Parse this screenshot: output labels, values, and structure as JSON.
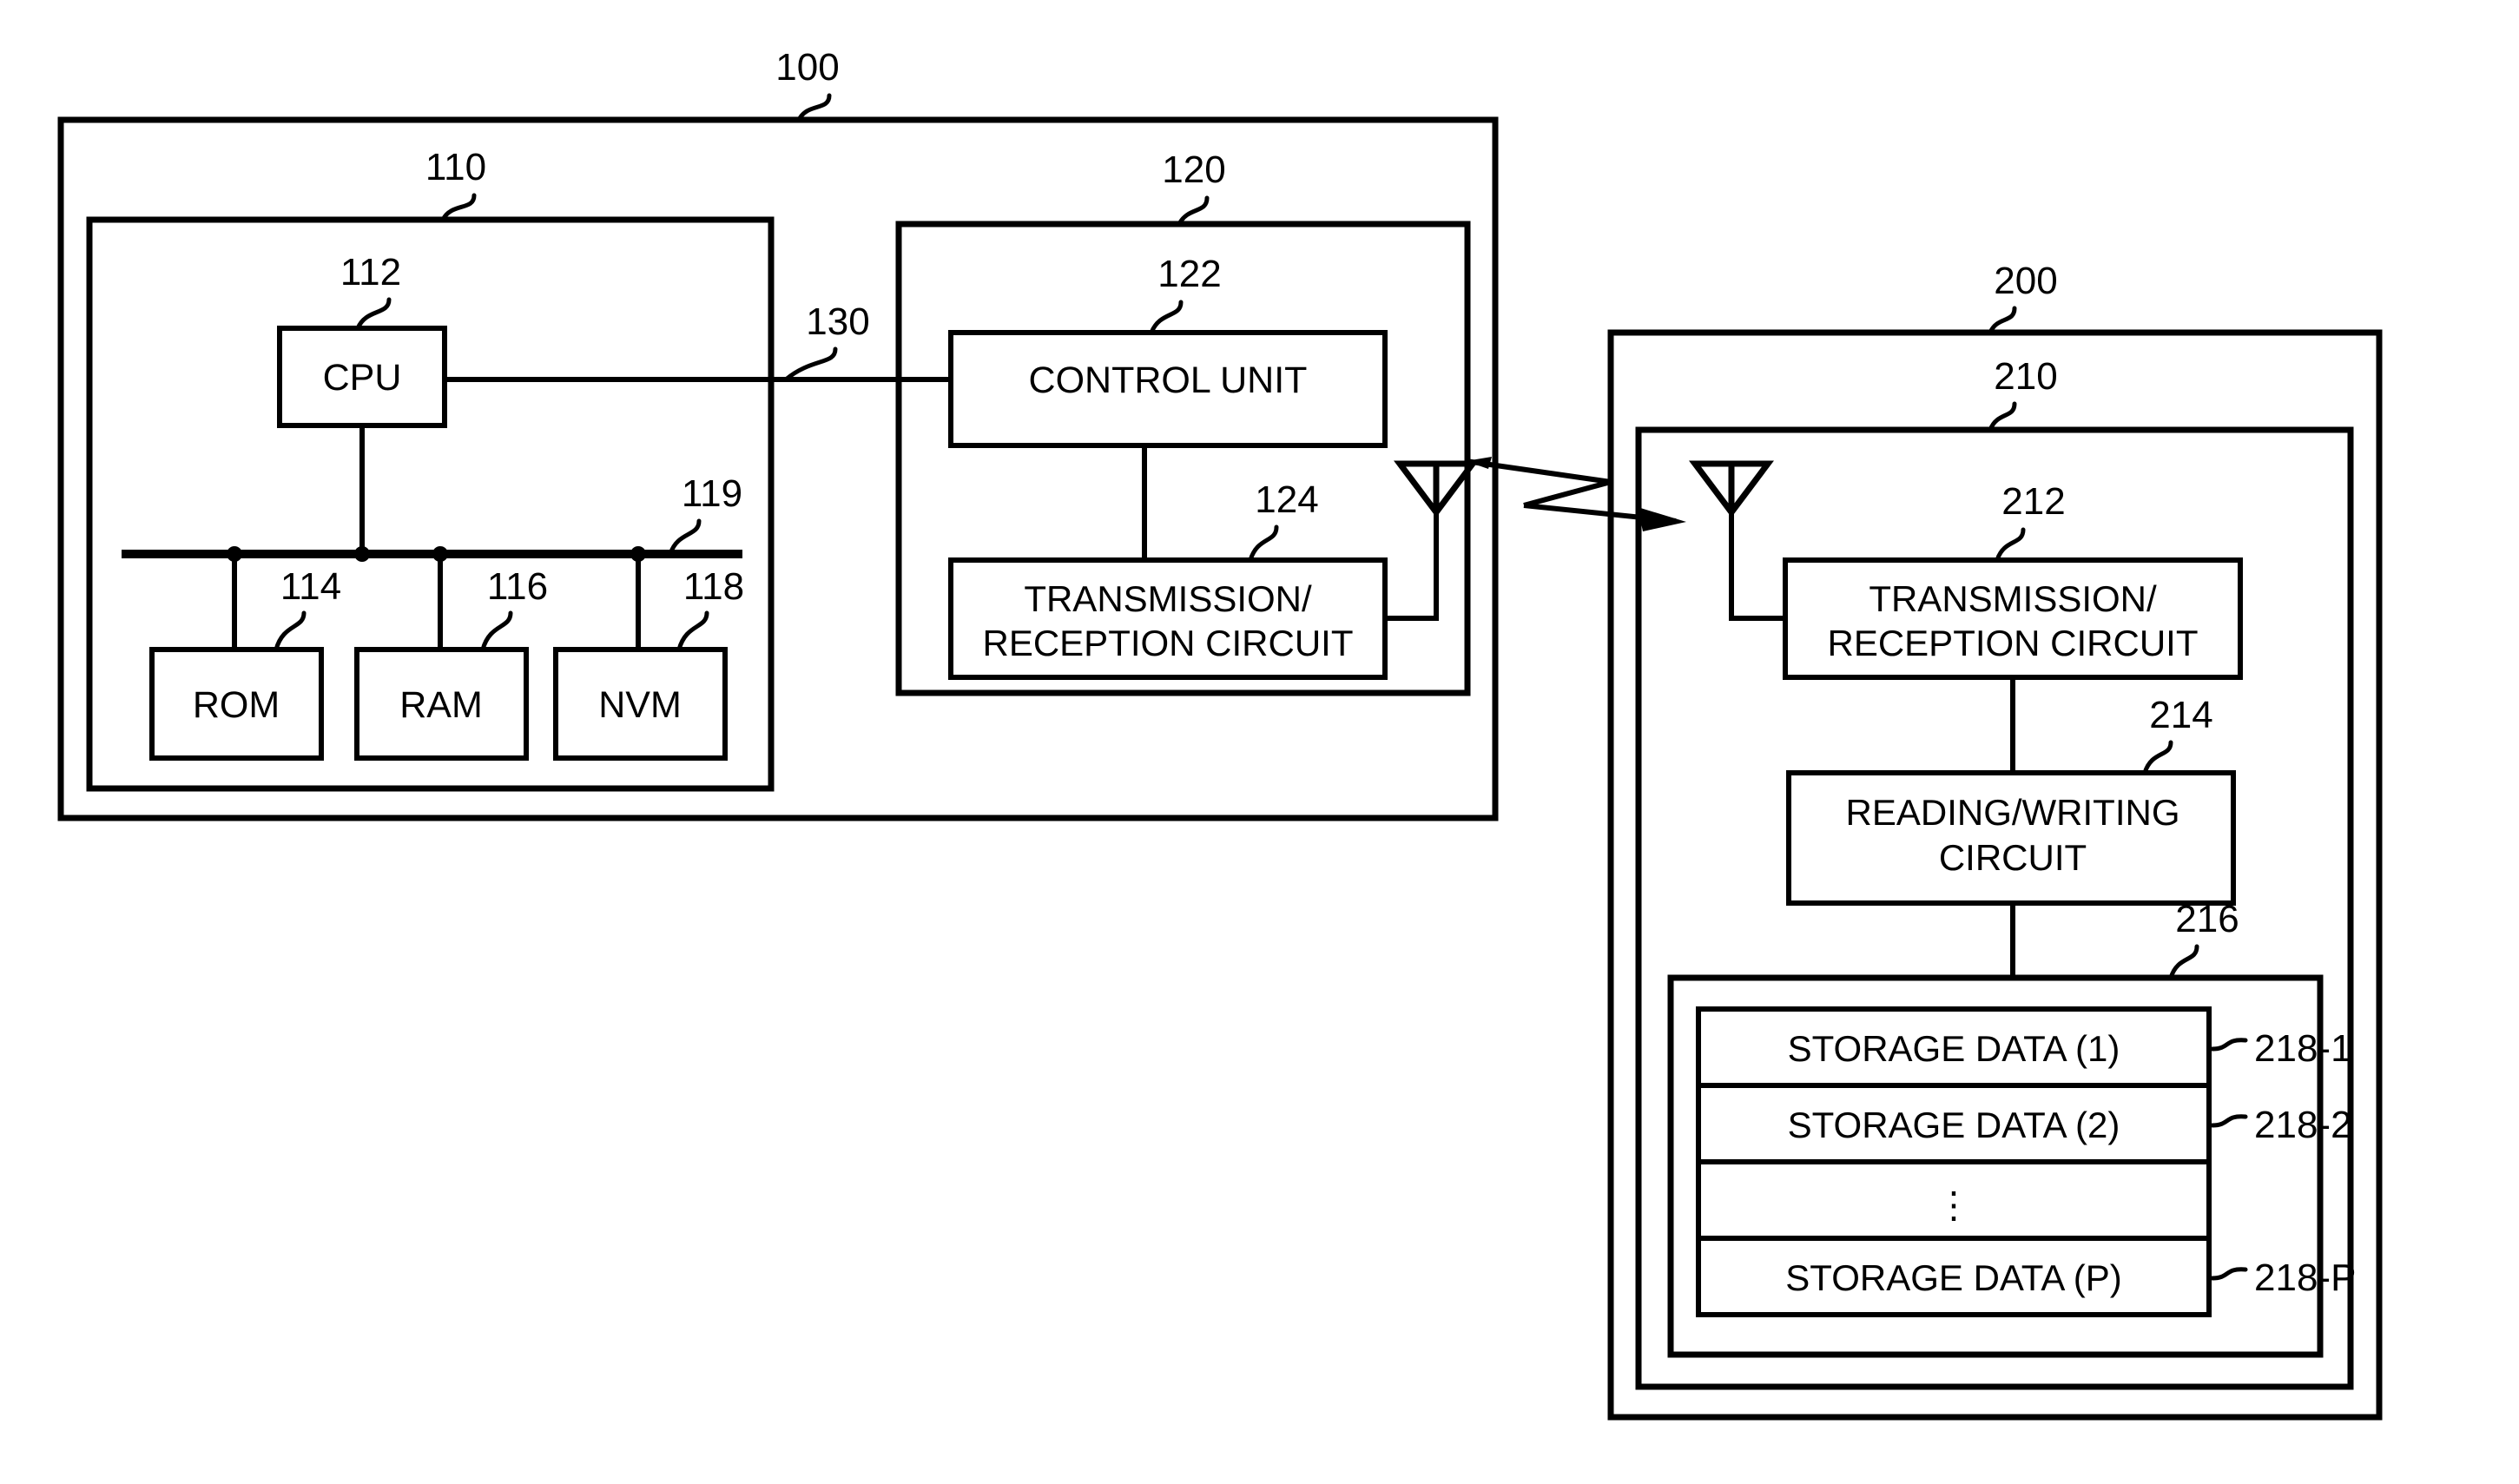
{
  "figure": {
    "type": "patent-block-diagram",
    "description": "Wireless reader/writer device and transponder storage device block diagram"
  },
  "reference_numerals": {
    "outer_device": "100",
    "controller_block": "110",
    "cpu": "112",
    "rom": "114",
    "ram": "116",
    "nvm": "118",
    "bus": "119",
    "comm_block": "120",
    "control_unit": "122",
    "tx_rx_circuit_host": "124",
    "interface_line": "130",
    "tag_device": "200",
    "tag_inner": "210",
    "tx_rx_circuit_tag": "212",
    "read_write_circuit": "214",
    "memory_block": "216",
    "storage_item_1": "218-1",
    "storage_item_2": "218-2",
    "storage_item_p": "218-P"
  },
  "blocks": {
    "cpu": {
      "label": "CPU"
    },
    "rom": {
      "label": "ROM"
    },
    "ram": {
      "label": "RAM"
    },
    "nvm": {
      "label": "NVM"
    },
    "control_unit": {
      "label": "CONTROL UNIT"
    },
    "tx_rx_host": {
      "line1": "TRANSMISSION/",
      "line2": "RECEPTION CIRCUIT"
    },
    "tx_rx_tag": {
      "line1": "TRANSMISSION/",
      "line2": "RECEPTION CIRCUIT"
    },
    "read_write": {
      "line1": "READING/WRITING",
      "line2": "CIRCUIT"
    }
  },
  "storage_list": [
    {
      "label": "STORAGE DATA (1)",
      "ref": "218-1"
    },
    {
      "label": "STORAGE DATA (2)",
      "ref": "218-2"
    },
    {
      "label": "⋮",
      "ref": ""
    },
    {
      "label": "STORAGE DATA (P)",
      "ref": "218-P"
    }
  ],
  "icons": {
    "antenna_host": "antenna-icon",
    "antenna_tag": "antenna-icon",
    "rf_link": "bidirectional-rf-arrow-icon"
  },
  "colors": {
    "stroke": "#000000",
    "background": "#ffffff"
  }
}
